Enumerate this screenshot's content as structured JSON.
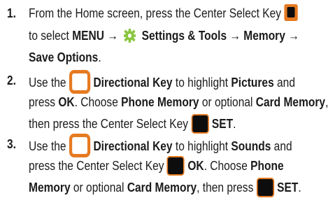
{
  "steps": [
    {
      "number": "1.",
      "line1_text": "From the Home screen, press the Center Select Key",
      "line2_pre": "to select ",
      "menu": "MENU",
      "arrow": "→",
      "settings_tools": "Settings & Tools",
      "memory": "Memory",
      "save_options": "Save Options",
      "period": "."
    },
    {
      "number": "2.",
      "use_the": "Use the",
      "directional_key": "Directional Key",
      "to_highlight": " to highlight ",
      "pictures": "Pictures",
      "and": " and",
      "press": "press ",
      "ok": "OK",
      "choose": ". Choose ",
      "phone_memory": "Phone Memory",
      "or_optional": " or optional ",
      "card_memory": "Card Memory",
      "comma": ",",
      "then_press": "then press the Center Select Key",
      "set": "SET",
      "period": "."
    },
    {
      "number": "3.",
      "use_the": "Use the",
      "directional_key": "Directional Key",
      "to_highlight": " to highlight ",
      "sounds": "Sounds",
      "and": " and",
      "press_center": "press the Center Select Key",
      "ok": "OK",
      "choose": ". Choose ",
      "phone": "Phone",
      "memory": "Memory",
      "or_optional": " or optional ",
      "card_memory": "Card Memory",
      "then_press": ", then press",
      "set": "SET",
      "period": "."
    }
  ],
  "icons": {
    "center_select_key": "orange-outlined-black-square-key",
    "directional_key": "orange-rounded-square-outline",
    "settings_tools": "green-gear-icon"
  },
  "colors": {
    "key_orange": "#e67a21",
    "text": "#1b1b1b",
    "gear_green": "#8ac640"
  }
}
